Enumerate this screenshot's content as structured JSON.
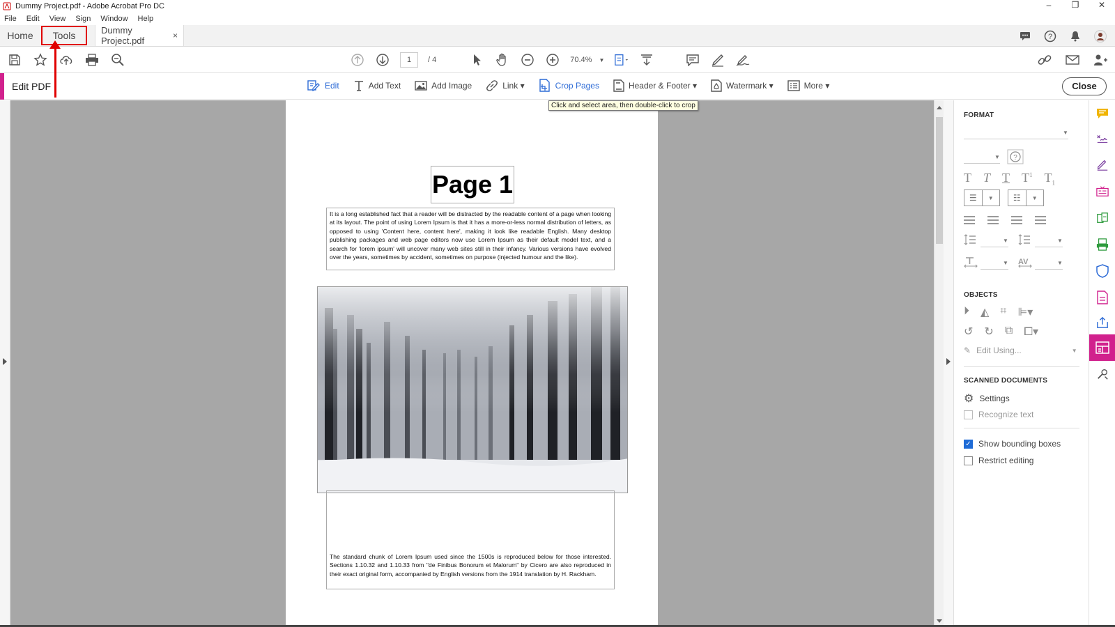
{
  "window": {
    "title": "Dummy Project.pdf - Adobe Acrobat Pro DC",
    "controls": [
      "–",
      "❐",
      "✕"
    ]
  },
  "menu": [
    "File",
    "Edit",
    "View",
    "Sign",
    "Window",
    "Help"
  ],
  "tabs": {
    "home": "Home",
    "tools": "Tools",
    "document": "Dummy Project.pdf",
    "close": "×"
  },
  "toolbar": {
    "page_current": "1",
    "page_total": "/ 4",
    "zoom": "70.4%"
  },
  "edit_bar": {
    "title": "Edit PDF",
    "tools": [
      {
        "label": "Edit",
        "icon": "edit-icon"
      },
      {
        "label": "Add Text",
        "icon": "text-icon"
      },
      {
        "label": "Add Image",
        "icon": "image-icon"
      },
      {
        "label": "Link ▾",
        "icon": "link-icon"
      },
      {
        "label": "Crop Pages",
        "icon": "crop-icon"
      },
      {
        "label": "Header & Footer ▾",
        "icon": "header-footer-icon"
      },
      {
        "label": "Watermark ▾",
        "icon": "watermark-icon"
      },
      {
        "label": "More ▾",
        "icon": "more-icon"
      }
    ],
    "close": "Close",
    "tooltip": "Click and select area, then double-click to crop"
  },
  "document": {
    "heading": "Page 1",
    "paragraph1": "It is a long established fact that a reader will be distracted by the readable content of a page when looking at its layout. The point of using Lorem Ipsum is that it has a more-or-less normal distribution of letters, as opposed to using 'Content here, content here', making it look like readable English. Many desktop publishing packages and web page editors now use Lorem Ipsum as their default model text, and a search for 'lorem ipsum' will uncover many web sites still in their infancy. Various versions have evolved over the years, sometimes by accident, sometimes on purpose (injected humour and the like).",
    "paragraph2": "The standard chunk of Lorem Ipsum used since the 1500s is reproduced below for those interested. Sections 1.10.32 and 1.10.33 from \"de Finibus Bonorum et Malorum\" by Cicero are also reproduced in their exact original form, accompanied by English versions from the 1914 translation by H. Rackham."
  },
  "panel": {
    "format_title": "FORMAT",
    "objects_title": "OBJECTS",
    "edit_using": "Edit Using...",
    "scanned_title": "SCANNED DOCUMENTS",
    "settings": "Settings",
    "recognize_text": "Recognize text",
    "show_bounding_boxes": "Show bounding boxes",
    "restrict_editing": "Restrict editing",
    "show_bounding_boxes_checked": true,
    "restrict_editing_checked": false
  },
  "colors": {
    "accent": "#d1218d",
    "link_blue": "#2d6bd6",
    "annotation_red": "#e00000"
  }
}
